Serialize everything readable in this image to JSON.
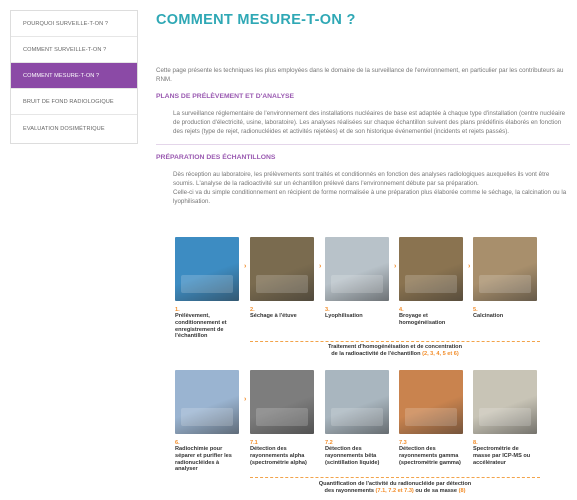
{
  "sidebar": {
    "items": [
      {
        "label": "POURQUOI SURVEILLE-T-ON ?"
      },
      {
        "label": "COMMENT SURVEILLE-T-ON ?"
      },
      {
        "label": "COMMENT MESURE-T-ON ?",
        "active": true
      },
      {
        "label": "BRUIT DE FOND RADIOLOGIQUE"
      },
      {
        "label": "EVALUATION DOSIMÉTRIQUE"
      }
    ]
  },
  "main": {
    "title": "COMMENT MESURE-T-ON ?",
    "intro": "Cette page présente les techniques les plus employées dans le domaine de la surveillance de l'environnement, en particulier par les contributeurs au RNM.",
    "section1": {
      "heading": "PLANS DE PRÉLÈVEMENT ET D'ANALYSE",
      "text": "La surveillance réglementaire de l'environnement des installations nucléaires de base est adaptée à chaque type d'installation (centre nucléaire de production d'électricité, usine, laboratoire). Les analyses réalisées sur chaque échantillon suivent des plans prédéfinis élaborés en fonction des rejets (type de rejet, radionucléides et activités rejetées) et de son historique événementiel (incidents et rejets passés)."
    },
    "section2": {
      "heading": "PRÉPARATION DES ÉCHANTILLONS",
      "text1": "Dès réception au laboratoire, les prélèvements sont traités et conditionnés en fonction des analyses radiologiques auxquelles ils vont être soumis. L'analyse de la radioactivité sur un échantillon prélevé dans l'environnement débute par sa préparation.",
      "text2": "Celle-ci va du simple conditionnement en récipient de forme normalisée à une préparation plus élaborée comme le séchage, la calcination ou la lyophilisation."
    }
  },
  "figure": {
    "row1": [
      {
        "num": "1.",
        "label": "Prélèvement, conditionnement et enregistrement de l'échantillon",
        "color": "#3d8cc2"
      },
      {
        "num": "2.",
        "label": "Séchage à l'étuve",
        "color": "#7a6b4f"
      },
      {
        "num": "3.",
        "label": "Lyophilisation",
        "color": "#b8c2c9"
      },
      {
        "num": "4.",
        "label": "Broyage et homogénéisation",
        "color": "#8a7350"
      },
      {
        "num": "5.",
        "label": "Calcination",
        "color": "#a88f6c"
      }
    ],
    "row2": [
      {
        "num": "6.",
        "label": "Radiochimie pour séparer et purifier les radionucléides à analyser",
        "color": "#9ab4d1"
      },
      {
        "num": "7.1",
        "label": "Détection des rayonnements alpha (spectrométrie alpha)",
        "color": "#7d7d7d"
      },
      {
        "num": "7.2",
        "label": "Détection des rayonnements bêta (scintillation liquide)",
        "color": "#a9b6bf"
      },
      {
        "num": "7.3",
        "label": "Détection des rayonnements gamma (spectrométrie gamma)",
        "color": "#c9834e"
      },
      {
        "num": "8.",
        "label": "Spectrométrie de masse par ICP-MS ou accélérateur",
        "color": "#c8c4b6"
      }
    ],
    "caption1_main": "Traitement d'homogénéisation et de concentration",
    "caption1_tail": "de la radioactivité de l'échantillon",
    "caption1_refs": "(2, 3, 4, 5 et 6)",
    "caption2_line1": "Quantification de l'activité du radionucléide par détection",
    "caption2_line2": "des rayonnements",
    "caption2_refs": "(7.1, 7.2 et 7.3)",
    "caption2_mid": "ou de sa masse",
    "caption2_ref8": "(8)"
  }
}
